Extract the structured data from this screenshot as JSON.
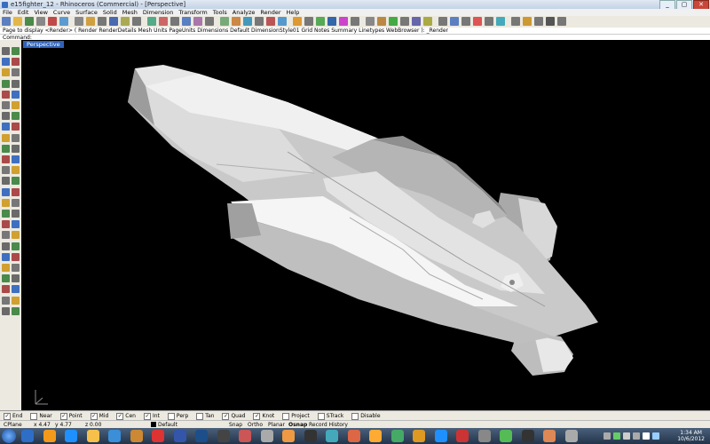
{
  "window": {
    "title": "e15fighter_12 - Rhinoceros (Commercial) - [Perspective]",
    "controls": [
      "_",
      "▢",
      "✕"
    ]
  },
  "menu": [
    "File",
    "Edit",
    "View",
    "Curve",
    "Surface",
    "Solid",
    "Mesh",
    "Dimension",
    "Transform",
    "Tools",
    "Analyze",
    "Render",
    "Help"
  ],
  "command_history": "Page to display <Render> ( Render  RenderDetails  Mesh  Units  PageUnits  Dimensions  Default  DimensionStyle01  Grid  Notes  Summary  Linetypes  WebBrowser ): _Render",
  "command_prompt": "Command:",
  "viewport": {
    "label": "Perspective",
    "axes": {
      "x": "x",
      "y": "y",
      "z": "z"
    }
  },
  "osnap": [
    {
      "label": "End",
      "checked": true
    },
    {
      "label": "Near",
      "checked": false
    },
    {
      "label": "Point",
      "checked": true
    },
    {
      "label": "Mid",
      "checked": true
    },
    {
      "label": "Cen",
      "checked": true
    },
    {
      "label": "Int",
      "checked": true
    },
    {
      "label": "Perp",
      "checked": false
    },
    {
      "label": "Tan",
      "checked": false
    },
    {
      "label": "Quad",
      "checked": true
    },
    {
      "label": "Knot",
      "checked": true
    },
    {
      "label": "Project",
      "checked": false
    },
    {
      "label": "STrack",
      "checked": false
    },
    {
      "label": "Disable",
      "checked": false
    }
  ],
  "status": {
    "cplane": "CPlane",
    "x": "x 4.47",
    "y": "y 4.77",
    "z": "z 0.00",
    "layer": "Default",
    "snap": "Snap",
    "ortho": "Ortho",
    "planar": "Planar",
    "osnap": "Osnap",
    "record_history": "Record History"
  },
  "clock": {
    "time": "1:34 AM",
    "date": "10/6/2012"
  }
}
